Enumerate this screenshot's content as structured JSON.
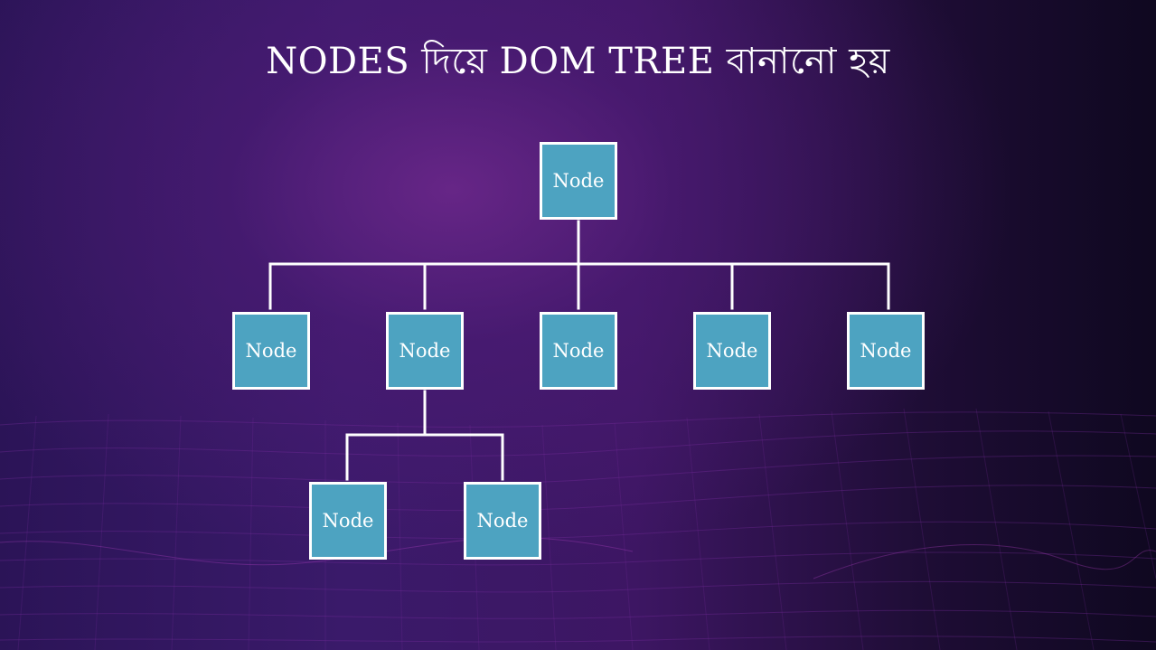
{
  "slide": {
    "title": "NODES দিয়ে DOM TREE বানানো হয়"
  },
  "tree": {
    "root": {
      "label": "Node"
    },
    "children": [
      {
        "label": "Node"
      },
      {
        "label": "Node",
        "children": [
          {
            "label": "Node"
          },
          {
            "label": "Node"
          }
        ]
      },
      {
        "label": "Node"
      },
      {
        "label": "Node"
      },
      {
        "label": "Node"
      }
    ]
  },
  "colors": {
    "node_fill": "#4da3c1",
    "node_border": "#ffffff",
    "connector": "#ffffff",
    "background_dark": "#1e0d35",
    "background_purple": "#5a1f7d"
  }
}
